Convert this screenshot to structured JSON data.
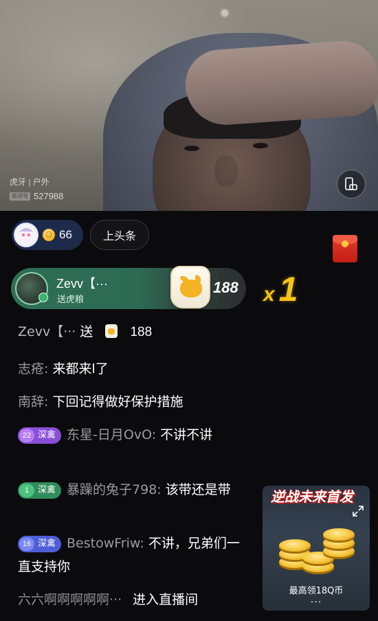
{
  "stream": {
    "platform_category": "虎牙 | 户外",
    "room_tag": "房间号",
    "room_number": "527988"
  },
  "topbar": {
    "audience_count": "66",
    "headline_button": "上头条"
  },
  "gift_banner": {
    "user": "Zevv【···",
    "action": "送虎粮",
    "count": "188",
    "combo_x": "x",
    "combo_n": "1"
  },
  "chat": {
    "gift_row": {
      "name": "Zevv【···",
      "action": "送",
      "count": "188"
    },
    "messages": [
      {
        "name": "志疮:",
        "text": "来都来l了"
      },
      {
        "name": "南辞:",
        "text": "下回记得做好保护措施"
      },
      {
        "badge_level": "22",
        "badge_label": "深禽",
        "name": "东星-日月OvO:",
        "text": "不讲不讲"
      },
      {
        "badge_level": "1",
        "badge_label": "深禽",
        "name": "暴躁的兔子798:",
        "text": "该带还是带"
      },
      {
        "badge_level": "16",
        "badge_label": "深禽",
        "name": "BestowFriw:",
        "text": "不讲，兄弟们一直支持你"
      }
    ],
    "enter": {
      "name": "六六啊啊啊啊啊···",
      "text": "进入直播间"
    }
  },
  "ad": {
    "title": "逆战未来首发",
    "text": "最高领18Q币",
    "dots": "···"
  },
  "colors": {
    "banner_green": "#2f6e55",
    "combo_gold": "#f6c318",
    "badge_purple": "#8a4fd6",
    "badge_green": "#2f8d5b",
    "badge_blue": "#4e5ed8",
    "background": "#0b0b0d"
  },
  "icons": [
    "screen-rotate-icon",
    "coin-icon",
    "red-packet-icon",
    "tiger-food-bag-icon",
    "expand-icon",
    "coins-icon"
  ]
}
